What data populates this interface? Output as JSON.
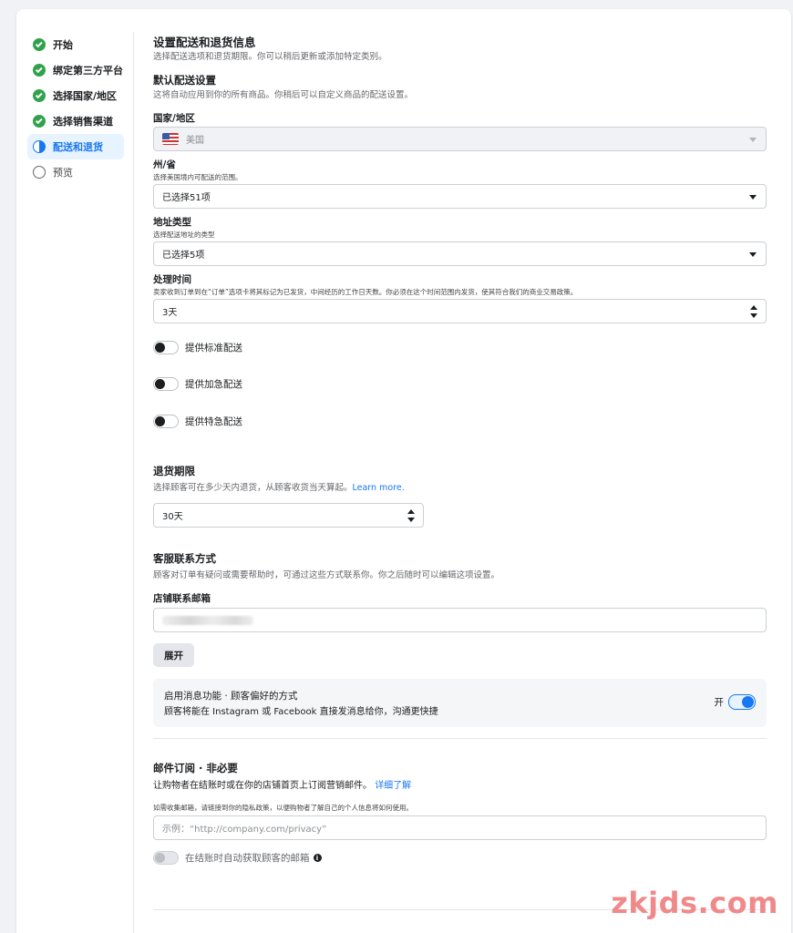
{
  "sidebar": {
    "steps": [
      {
        "label": "开始",
        "state": "done"
      },
      {
        "label": "绑定第三方平台",
        "state": "done"
      },
      {
        "label": "选择国家/地区",
        "state": "done"
      },
      {
        "label": "选择销售渠道",
        "state": "done"
      },
      {
        "label": "配送和退货",
        "state": "active"
      },
      {
        "label": "预览",
        "state": "todo"
      }
    ]
  },
  "header": {
    "title": "设置配送和退货信息",
    "subtitle": "选择配送选项和退货期限。你可以稍后更新或添加特定类别。"
  },
  "default_shipping": {
    "title": "默认配送设置",
    "subtitle": "这将自动应用到你的所有商品。你稍后可以自定义商品的配送设置。"
  },
  "country": {
    "label": "国家/地区",
    "value": "美国"
  },
  "state": {
    "label": "州/省",
    "help": "选择美国境内可配送的范围。",
    "value": "已选择51项"
  },
  "address_type": {
    "label": "地址类型",
    "help": "选择配送地址的类型",
    "value": "已选择5项"
  },
  "processing": {
    "label": "处理时间",
    "help": "卖家收到订单到在“订单”选项卡将其标记为已发货，中间经历的工作日天数。你必须在这个时间范围内发货，使其符合我们的商业交易政策。",
    "value": "3天"
  },
  "shipping_toggles": [
    {
      "label": "提供标准配送",
      "on": false
    },
    {
      "label": "提供加急配送",
      "on": false
    },
    {
      "label": "提供特急配送",
      "on": false
    }
  ],
  "returns": {
    "title": "退货期限",
    "subtitle": "选择顾客可在多少天内退货，从顾客收货当天算起。",
    "link": "Learn more.",
    "value": "30天"
  },
  "customer_service": {
    "title": "客服联系方式",
    "subtitle": "顾客对订单有疑问或需要帮助时，可通过这些方式联系你。你之后随时可以编辑这项设置。",
    "email_label": "店铺联系邮箱",
    "expand_label": "展开"
  },
  "messaging": {
    "title": "启用消息功能 · 顾客偏好的方式",
    "description": "顾客将能在 Instagram 或 Facebook 直接发消息给你，沟通更快捷",
    "toggle_text": "开",
    "on": true
  },
  "email_subscription": {
    "title": "邮件订阅 · 非必要",
    "subtitle": "让购物者在结账时或在你的店铺首页上订阅营销邮件。",
    "link": "详细了解",
    "privacy_help": "如需收集邮箱，请链接到你的隐私政策，以便购物者了解自己的个人信息将如何使用。",
    "placeholder": "示例：“http://company.com/privacy”",
    "auto_collect_label": "在结账时自动获取顾客的邮箱",
    "info_icon": "i"
  },
  "watermark": "zkjds.com",
  "colors": {
    "accent": "#1877f2",
    "done": "#31a24c"
  }
}
